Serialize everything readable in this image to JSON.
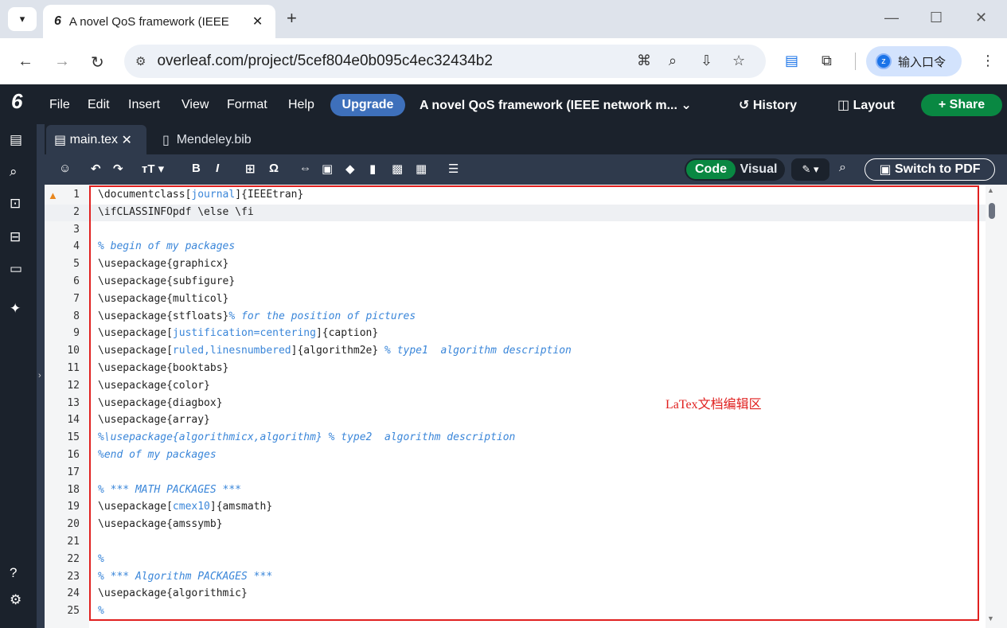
{
  "browser": {
    "tab_title": "A novel QoS framework (IEEE",
    "tab_favicon": "6",
    "url": "overleaf.com/project/5cef804e0b095c4ec32434b2",
    "profile_label": "输入口令",
    "profile_initial": "z"
  },
  "overleaf": {
    "logo": "6",
    "menu": [
      "File",
      "Edit",
      "Insert",
      "View",
      "Format",
      "Help"
    ],
    "upgrade_label": "Upgrade",
    "project_title": "A novel QoS framework (IEEE network m... ⌄",
    "history_label": "History",
    "layout_label": "Layout",
    "share_label": "Share"
  },
  "file_tabs": {
    "active": "main.tex",
    "other": "Mendeley.bib"
  },
  "editor_toolbar": {
    "code_label": "Code",
    "visual_label": "Visual",
    "switch_pdf_label": "Switch to PDF"
  },
  "code_lines": [
    {
      "n": "1",
      "parts": [
        [
          "\\documentclass[",
          ""
        ],
        [
          "journal",
          "arg"
        ],
        [
          "]{IEEEtran}",
          ""
        ]
      ]
    },
    {
      "n": "2",
      "parts": [
        [
          "\\ifCLASSINFOpdf \\else \\fi",
          ""
        ]
      ]
    },
    {
      "n": "3",
      "parts": []
    },
    {
      "n": "4",
      "parts": [
        [
          "% begin of my packages",
          "cmt"
        ]
      ]
    },
    {
      "n": "5",
      "parts": [
        [
          "\\usepackage{graphicx}",
          ""
        ]
      ]
    },
    {
      "n": "6",
      "parts": [
        [
          "\\usepackage{subfigure}",
          ""
        ]
      ]
    },
    {
      "n": "7",
      "parts": [
        [
          "\\usepackage{multicol}",
          ""
        ]
      ]
    },
    {
      "n": "8",
      "parts": [
        [
          "\\usepackage{stfloats}",
          ""
        ],
        [
          "% for the position of pictures",
          "cmt"
        ]
      ]
    },
    {
      "n": "9",
      "parts": [
        [
          "\\usepackage[",
          ""
        ],
        [
          "justification=centering",
          "arg"
        ],
        [
          "]{caption}",
          ""
        ]
      ]
    },
    {
      "n": "10",
      "parts": [
        [
          "\\usepackage[",
          ""
        ],
        [
          "ruled,linesnumbered",
          "arg"
        ],
        [
          "]{algorithm2e} ",
          ""
        ],
        [
          "% type1  algorithm description",
          "cmt"
        ]
      ]
    },
    {
      "n": "11",
      "parts": [
        [
          "\\usepackage{booktabs}",
          ""
        ]
      ]
    },
    {
      "n": "12",
      "parts": [
        [
          "\\usepackage{color}",
          ""
        ]
      ]
    },
    {
      "n": "13",
      "parts": [
        [
          "\\usepackage{diagbox}",
          ""
        ]
      ]
    },
    {
      "n": "14",
      "parts": [
        [
          "\\usepackage{array}",
          ""
        ]
      ]
    },
    {
      "n": "15",
      "parts": [
        [
          "%\\usepackage{algorithmicx,algorithm} % type2  algorithm description",
          "cmt"
        ]
      ]
    },
    {
      "n": "16",
      "parts": [
        [
          "%end of my packages",
          "cmt"
        ]
      ]
    },
    {
      "n": "17",
      "parts": []
    },
    {
      "n": "18",
      "parts": [
        [
          "% *** MATH PACKAGES ***",
          "cmt"
        ]
      ]
    },
    {
      "n": "19",
      "parts": [
        [
          "\\usepackage[",
          ""
        ],
        [
          "cmex10",
          "arg"
        ],
        [
          "]{amsmath}",
          ""
        ]
      ]
    },
    {
      "n": "20",
      "parts": [
        [
          "\\usepackage{amssymb}",
          ""
        ]
      ]
    },
    {
      "n": "21",
      "parts": []
    },
    {
      "n": "22",
      "parts": [
        [
          "%",
          "cmt"
        ]
      ]
    },
    {
      "n": "23",
      "parts": [
        [
          "% *** Algorithm PACKAGES ***",
          "cmt"
        ]
      ]
    },
    {
      "n": "24",
      "parts": [
        [
          "\\usepackage{algorithmic}",
          ""
        ]
      ]
    },
    {
      "n": "25",
      "parts": [
        [
          "%",
          "cmt"
        ]
      ]
    }
  ],
  "annotation": "LaTex文档编辑区",
  "colors": {
    "accent_green": "#098842",
    "upgrade_blue": "#3e70bb",
    "annotation_red": "#e0201f",
    "comment_blue": "#3a86d9"
  }
}
